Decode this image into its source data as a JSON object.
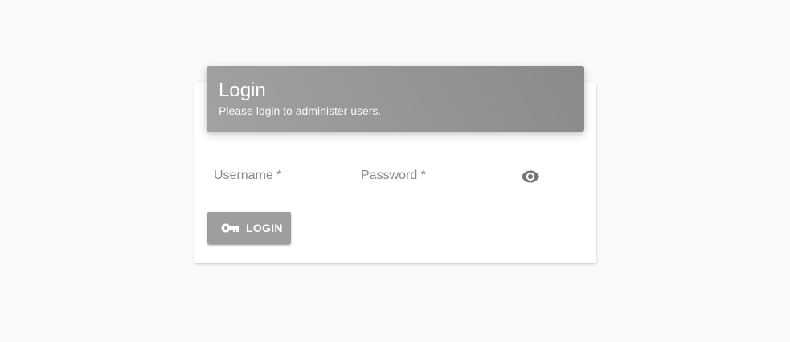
{
  "login_card": {
    "title": "Login",
    "subtitle": "Please login to administer users.",
    "username": {
      "placeholder": "Username *",
      "value": ""
    },
    "password": {
      "placeholder": "Password *",
      "value": "",
      "toggle_icon": "eye-icon"
    },
    "submit": {
      "label": "LOGIN",
      "icon": "key-icon"
    }
  },
  "colors": {
    "background": "#fafafa",
    "header_gradient_start": "#a2a2a2",
    "header_gradient_end": "#8a8a8a",
    "button": "#9e9e9e",
    "icon": "#757575"
  }
}
